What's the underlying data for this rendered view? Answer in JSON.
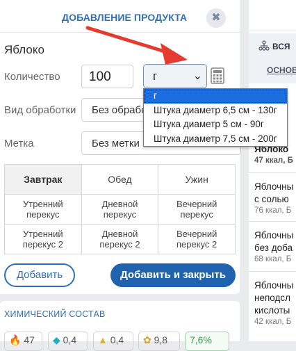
{
  "modal": {
    "title": "ДОБАВЛЕНИЕ ПРОДУКТА",
    "close_icon": "✖",
    "product_name": "Яблоко",
    "quantity_label": "Количество",
    "quantity_value": "100",
    "unit_selected": "г",
    "processing_label": "Вид обработки",
    "processing_value": "Без обработки",
    "tag_label": "Метка",
    "tag_value": "Без метки",
    "unit_options": [
      "г",
      "Штука диаметр 6,5 см - 130г",
      "Штука диаметр 5 см - 90г",
      "Штука диаметр 7,5 см - 200г"
    ],
    "meals": [
      [
        "Завтрак",
        "Обед",
        "Ужин"
      ],
      [
        "Утренний перекус",
        "Дневной перекус",
        "Вечерний перекус"
      ],
      [
        "Утренний перекус 2",
        "Дневной перекус 2",
        "Вечерний перекус 2"
      ]
    ],
    "active_meal": "Завтрак",
    "add_button": "Добавить",
    "add_close_button": "Добавить и закрыть"
  },
  "chem": {
    "title": "ХИМИЧЕСКИЙ СОСТАВ",
    "badges": [
      "47",
      "0,4",
      "0,4",
      "9,8",
      "7,6%"
    ]
  },
  "right_panel": {
    "all_label": "ВСЯ",
    "basic_label": "ОСНОВ",
    "items": [
      {
        "name": "Яблоко",
        "info": "47 ккал, Б"
      },
      {
        "name": "Яблочны",
        "name2": "с солью",
        "info": "76 ккал, Б"
      },
      {
        "name": "Яблочны",
        "name2": "без доба",
        "info": "68 ккал, Б"
      },
      {
        "name": "Яблочны",
        "name2": "неподсл",
        "name3": "кислоты",
        "info": "42 ккал, Б"
      }
    ]
  },
  "colors": {
    "accent": "#2f6fb5",
    "primary_button": "#1f63ae",
    "selected_option": "#1a6ee0",
    "arrow": "#e53b2f"
  }
}
